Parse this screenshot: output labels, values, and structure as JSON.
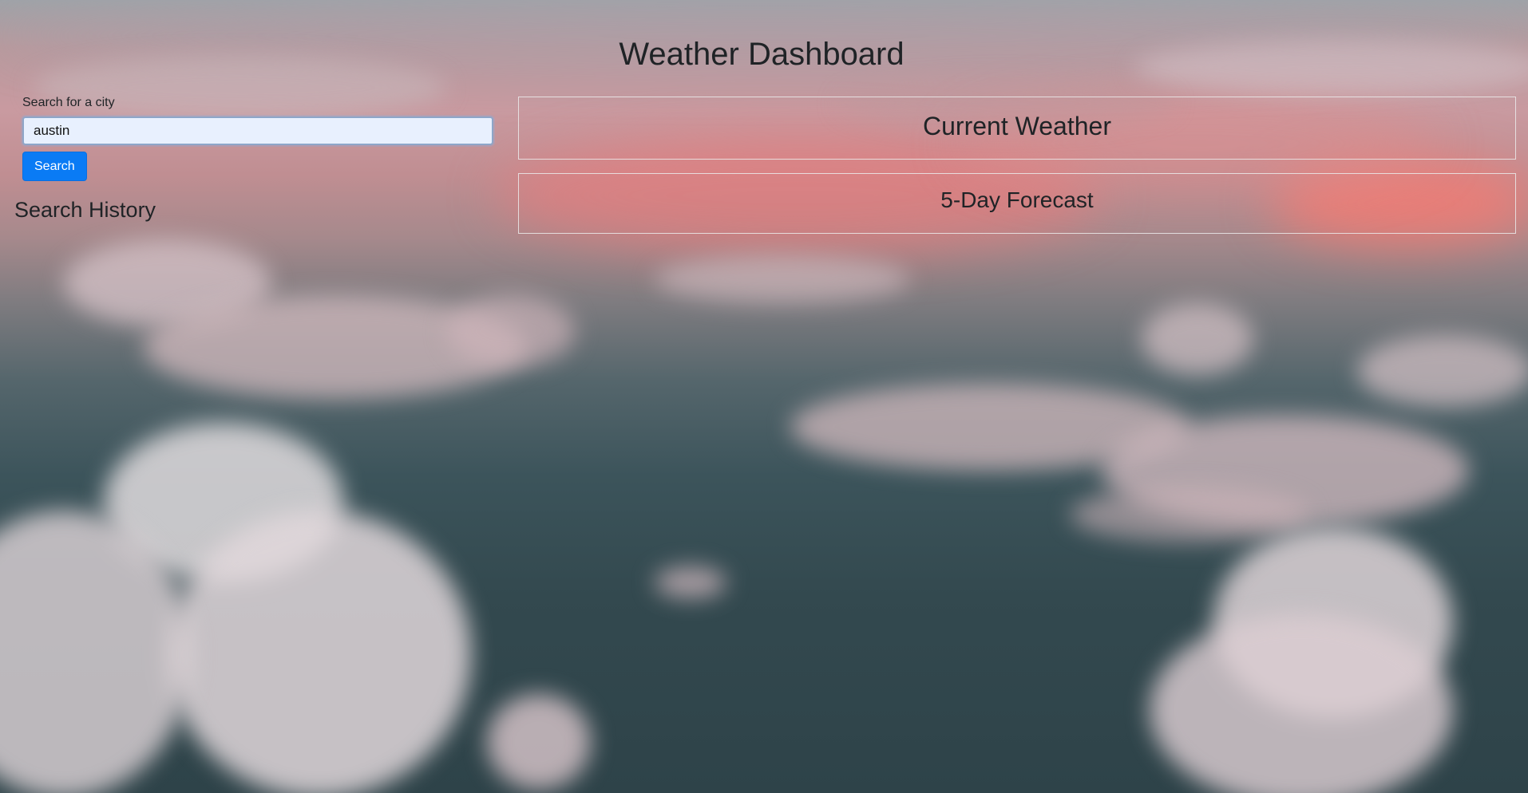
{
  "header": {
    "title": "Weather Dashboard"
  },
  "search": {
    "label": "Search for a city",
    "value": "austin",
    "button_label": "Search"
  },
  "history": {
    "title": "Search History"
  },
  "current_weather": {
    "title": "Current Weather"
  },
  "forecast": {
    "title": "5-Day Forecast"
  },
  "colors": {
    "button": "#0a7bf5",
    "input_background": "#e8f0fe",
    "text": "#1f2326"
  }
}
